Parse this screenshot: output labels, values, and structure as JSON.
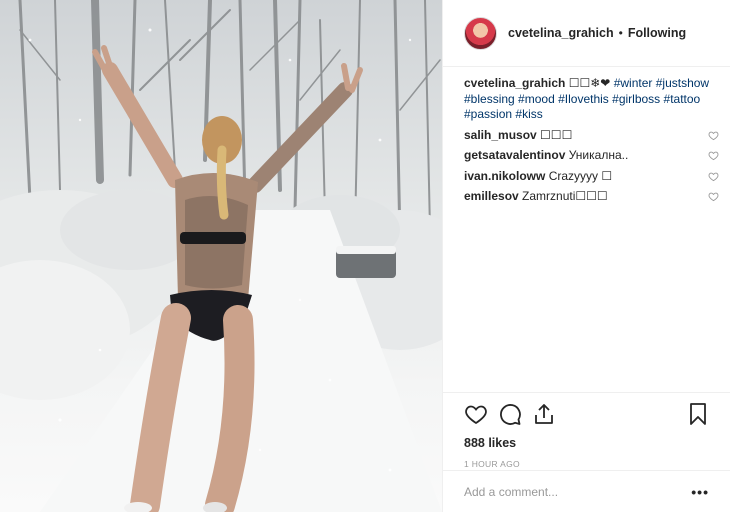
{
  "post": {
    "photo_alt": "",
    "header": {
      "username": "cvetelina_grahich",
      "separator": "•",
      "follow_status": "Following"
    },
    "caption": {
      "username": "cvetelina_grahich",
      "emoji": "☐☐❄❤",
      "hashtags": [
        "#winter",
        "#justshow",
        "#blessing",
        "#mood",
        "#Ilovethis",
        "#girlboss",
        "#tattoo",
        "#passion",
        "#kiss"
      ]
    },
    "comments": [
      {
        "username": "salih_musov",
        "text": "☐☐☐"
      },
      {
        "username": "getsatavalentinov",
        "text": "Уникална.."
      },
      {
        "username": "ivan.nikoloww",
        "text": "Crazyyyy ☐"
      },
      {
        "username": "emillesov",
        "text": "Zamrznuti☐☐☐"
      }
    ],
    "likes": "888 likes",
    "time": "1 HOUR AGO",
    "add_comment_placeholder": "Add a comment...",
    "more_label": "•••",
    "colors": {
      "hashtag": "#003569",
      "border": "#efefef",
      "muted": "#999999"
    }
  }
}
